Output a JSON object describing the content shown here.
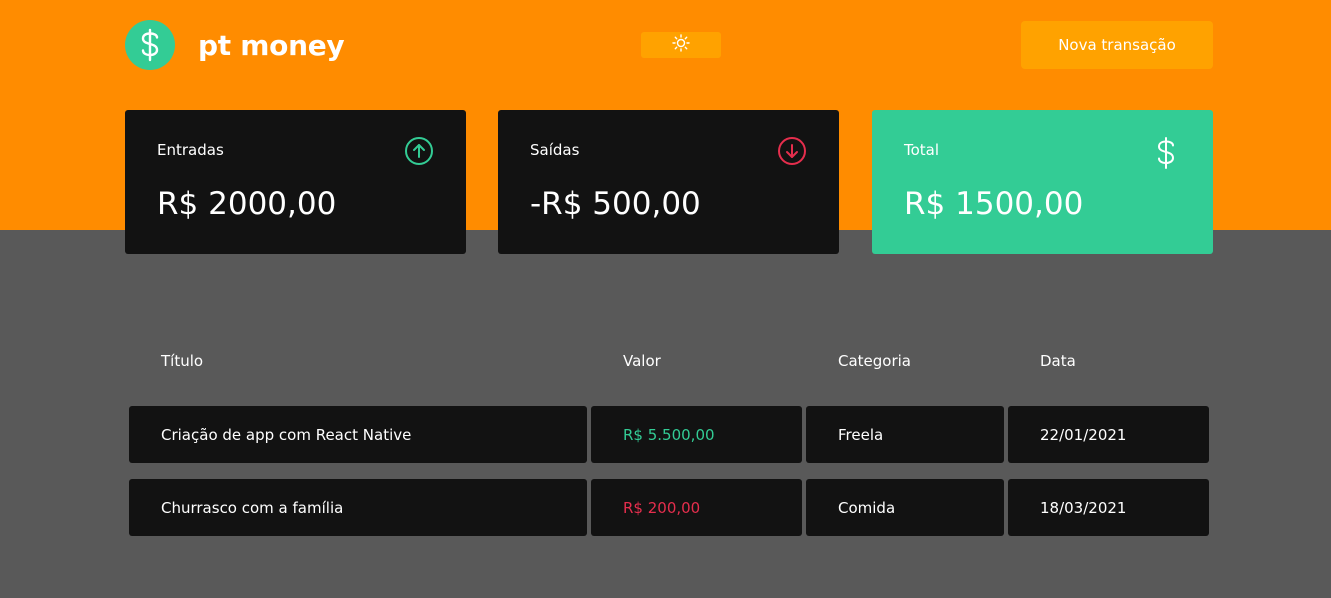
{
  "app": {
    "name": "pt money"
  },
  "header": {
    "theme_toggle_icon": "sun-icon",
    "new_transaction_label": "Nova transação"
  },
  "summary": {
    "income": {
      "label": "Entradas",
      "value": "R$ 2000,00",
      "icon": "arrow-up-circle-icon",
      "color": "#33cc95"
    },
    "outcome": {
      "label": "Saídas",
      "value": "-R$ 500,00",
      "icon": "arrow-down-circle-icon",
      "color": "#e52e4d"
    },
    "total": {
      "label": "Total",
      "value": "R$ 1500,00",
      "icon": "dollar-icon",
      "color": "#33cc95"
    }
  },
  "table": {
    "headers": [
      "Título",
      "Valor",
      "Categoria",
      "Data"
    ],
    "rows": [
      {
        "title": "Criação de app com React Native",
        "amount": "R$ 5.500,00",
        "type": "income",
        "category": "Freela",
        "date": "22/01/2021"
      },
      {
        "title": "Churrasco com a família",
        "amount": "R$ 200,00",
        "type": "outcome",
        "category": "Comida",
        "date": "18/03/2021"
      }
    ]
  },
  "colors": {
    "brand_orange": "#ff8c00",
    "button_orange": "#ffa200",
    "green": "#33cc95",
    "red": "#e52e4d",
    "card_dark": "#121212",
    "page_gray": "#595959"
  }
}
